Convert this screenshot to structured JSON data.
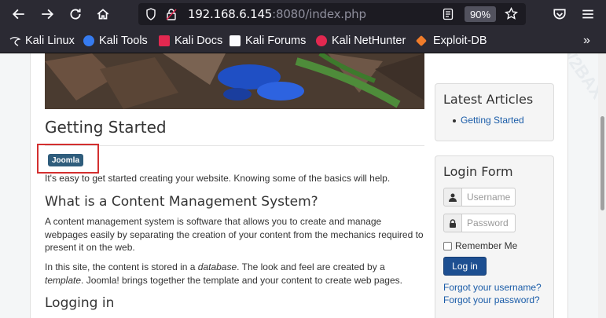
{
  "browser": {
    "url_host": "192.168.6.145",
    "url_rest": ":8080/index.php",
    "zoom": "90%",
    "bookmarks": [
      "Kali Linux",
      "Kali Tools",
      "Kali Docs",
      "Kali Forums",
      "Kali NetHunter",
      "Exploit-DB"
    ]
  },
  "article": {
    "title": "Getting Started",
    "tag": "Joomla",
    "intro": "It's easy to get started creating your website. Knowing some of the basics will help.",
    "section1_title": "What is a Content Management System?",
    "section1_p1": "A content management system is software that allows you to create and manage webpages easily by separating the creation of your content from the mechanics required to present it on the web.",
    "section1_p2_a": "In this site, the content is stored in a ",
    "section1_p2_em1": "database",
    "section1_p2_b": ". The look and feel are created by a ",
    "section1_p2_em2": "template",
    "section1_p2_c": ". Joomla! brings together the template and your content to create web pages.",
    "section2_title": "Logging in"
  },
  "sidebar": {
    "latest_title": "Latest Articles",
    "latest_items": [
      "Getting Started"
    ],
    "login_title": "Login Form",
    "username_placeholder": "Username",
    "password_placeholder": "Password",
    "remember_label": "Remember Me",
    "login_button": "Log in",
    "forgot_username": "Forgot your username?",
    "forgot_password": "Forgot your password?"
  },
  "colors": {
    "tag_bg": "#2f5d7c",
    "link": "#1a5ca8",
    "login_btn": "#1d4f91",
    "highlight": "#d32f2f"
  }
}
